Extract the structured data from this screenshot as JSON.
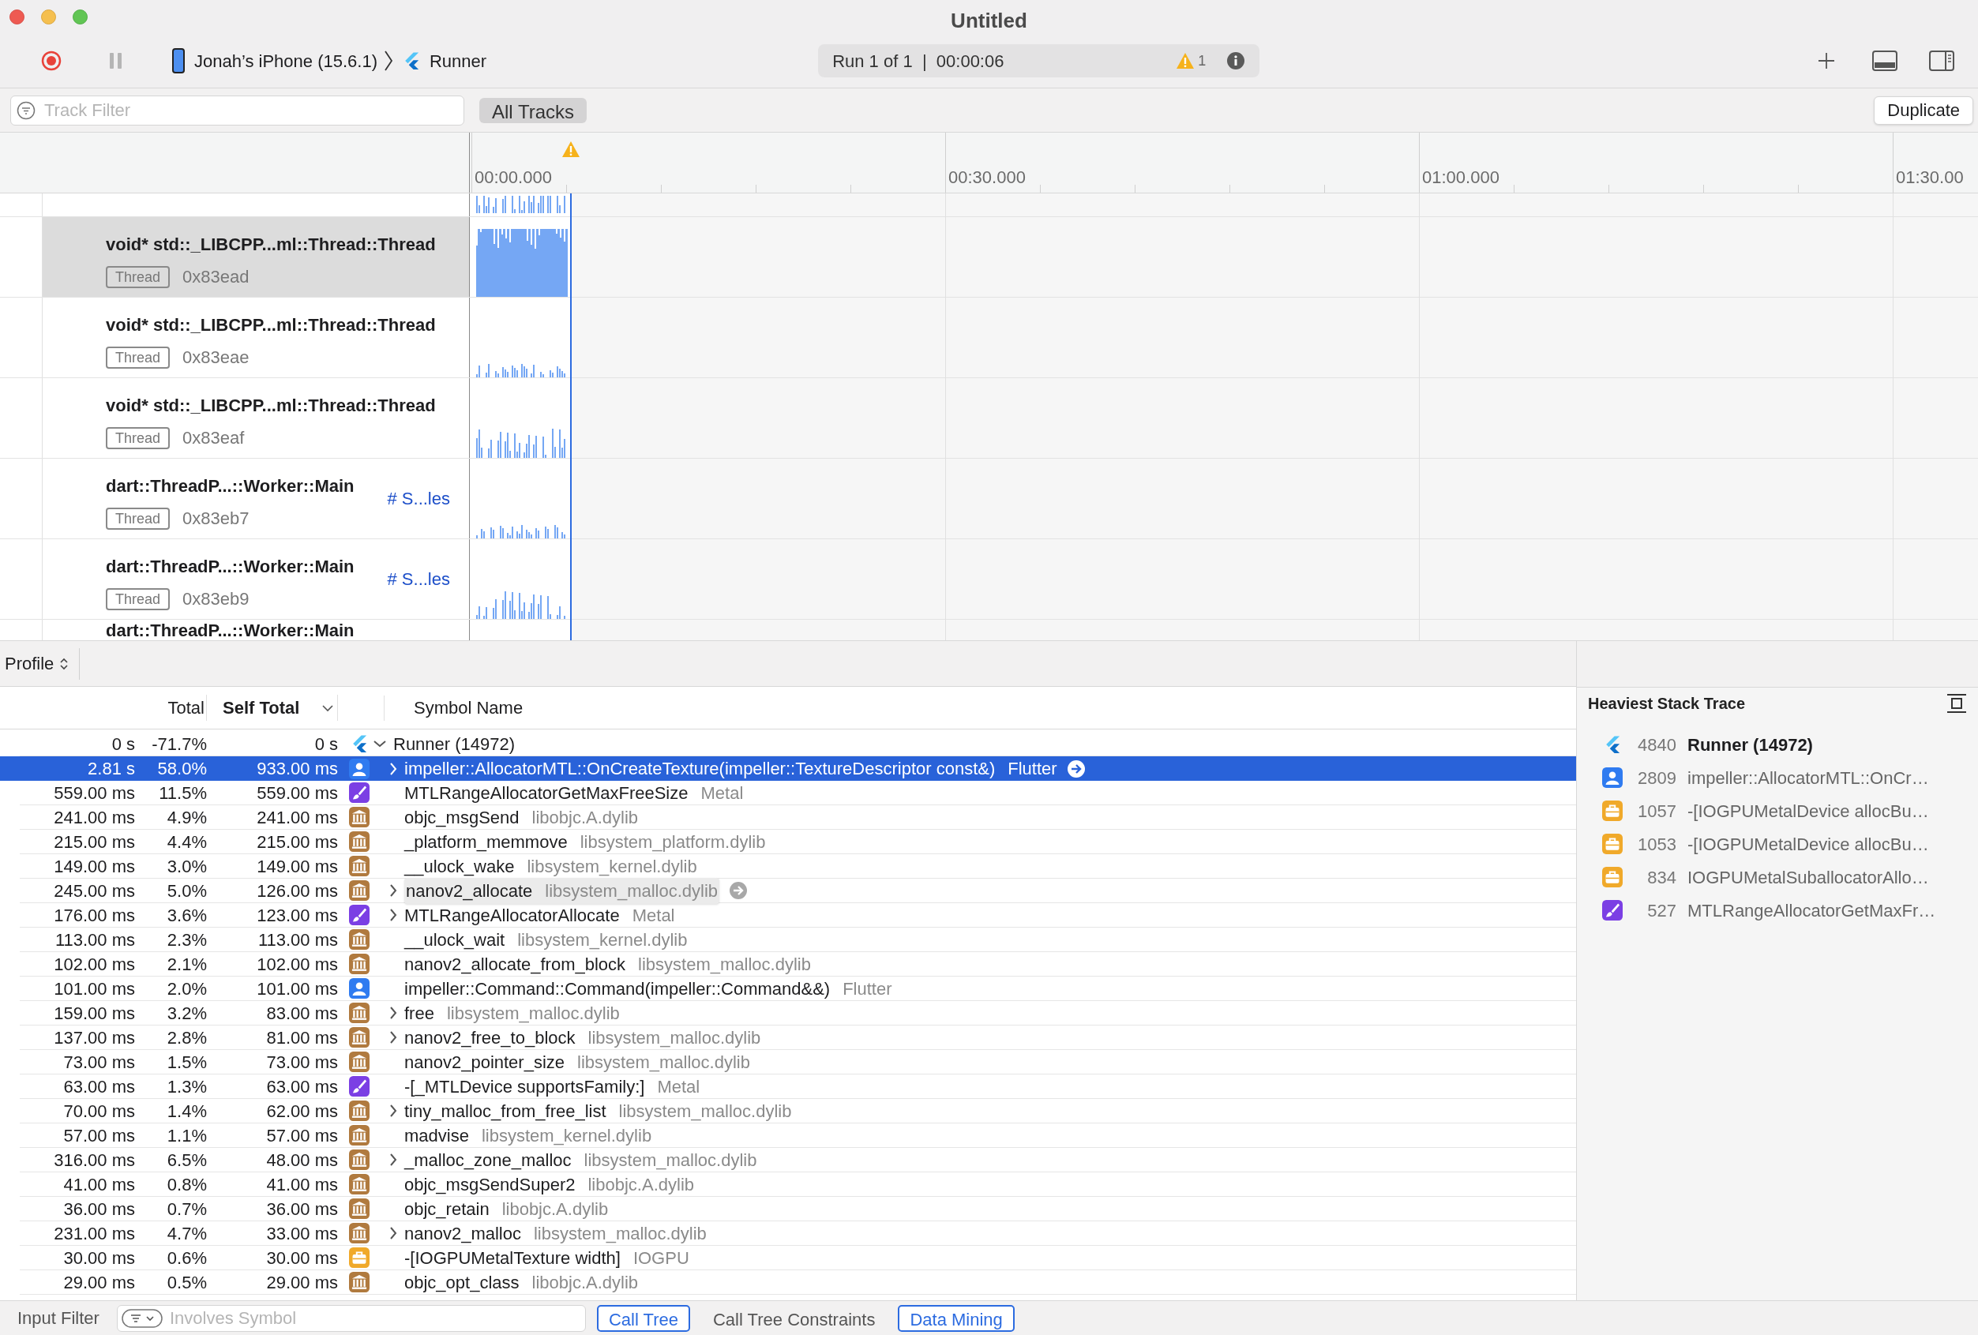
{
  "window": {
    "title": "Untitled"
  },
  "toolbar": {
    "device": "Jonah’s iPhone (15.6.1)",
    "target": "Runner",
    "run_status": "Run 1 of 1  |  00:00:06",
    "warning_count": "1"
  },
  "filter_bar": {
    "placeholder": "Track Filter",
    "scope_button": "All Tracks",
    "duplicate_button": "Duplicate"
  },
  "timeline": {
    "ticks": [
      "00:00.000",
      "00:30.000",
      "01:00.000",
      "01:30.00"
    ]
  },
  "tracks": [
    {
      "name": "void* std::_LIBCPP...ml::Thread::Thread",
      "tag": "Thread",
      "id": "0x83ead",
      "selected": true
    },
    {
      "name": "void* std::_LIBCPP...ml::Thread::Thread",
      "tag": "Thread",
      "id": "0x83eae",
      "selected": false
    },
    {
      "name": "void* std::_LIBCPP...ml::Thread::Thread",
      "tag": "Thread",
      "id": "0x83eaf",
      "selected": false
    },
    {
      "name": "dart::ThreadP...::Worker::Main",
      "tag": "Thread",
      "id": "0x83eb7",
      "link": "# S...les",
      "selected": false
    },
    {
      "name": "dart::ThreadP...::Worker::Main",
      "tag": "Thread",
      "id": "0x83eb9",
      "link": "# S...les",
      "selected": false
    },
    {
      "name": "dart::ThreadP...::Worker::Main",
      "selected": false
    }
  ],
  "profile": {
    "view_menu": "Profile",
    "columns": {
      "total": "Total",
      "self_total": "Self Total",
      "symbol": "Symbol Name"
    },
    "rows": [
      {
        "total": "0 s",
        "percent": "-71.7%",
        "self": "0 s",
        "kind": "flutter",
        "expandable": true,
        "expanded": true,
        "symbol": "Runner (14972)",
        "selected": false,
        "focused": false,
        "children": [
          {
            "total": "2.81 s",
            "percent": "58.0%",
            "self": "933.00 ms",
            "kind": "user",
            "expandable": true,
            "expanded": false,
            "symbol": "impeller::AllocatorMTL::OnCreateTexture(impeller::TextureDescriptor const&)",
            "library": "Flutter",
            "selected": true,
            "focused": false
          },
          {
            "total": "559.00 ms",
            "percent": "11.5%",
            "self": "559.00 ms",
            "kind": "metal",
            "expandable": false,
            "symbol": "MTLRangeAllocatorGetMaxFreeSize",
            "library": "Metal",
            "selected": false,
            "focused": false
          },
          {
            "total": "241.00 ms",
            "percent": "4.9%",
            "self": "241.00 ms",
            "kind": "library",
            "expandable": false,
            "symbol": "objc_msgSend",
            "library": "libobjc.A.dylib",
            "selected": false,
            "focused": false
          },
          {
            "total": "215.00 ms",
            "percent": "4.4%",
            "self": "215.00 ms",
            "kind": "library",
            "expandable": false,
            "symbol": "_platform_memmove",
            "library": "libsystem_platform.dylib",
            "selected": false,
            "focused": false
          },
          {
            "total": "149.00 ms",
            "percent": "3.0%",
            "self": "149.00 ms",
            "kind": "library",
            "expandable": false,
            "symbol": "__ulock_wake",
            "library": "libsystem_kernel.dylib",
            "selected": false,
            "focused": false
          },
          {
            "total": "245.00 ms",
            "percent": "5.0%",
            "self": "126.00 ms",
            "kind": "library",
            "expandable": true,
            "expanded": false,
            "symbol": "nanov2_allocate",
            "library": "libsystem_malloc.dylib",
            "selected": false,
            "focused": true
          },
          {
            "total": "176.00 ms",
            "percent": "3.6%",
            "self": "123.00 ms",
            "kind": "metal",
            "expandable": true,
            "expanded": false,
            "symbol": "MTLRangeAllocatorAllocate",
            "library": "Metal",
            "selected": false,
            "focused": false
          },
          {
            "total": "113.00 ms",
            "percent": "2.3%",
            "self": "113.00 ms",
            "kind": "library",
            "expandable": false,
            "symbol": "__ulock_wait",
            "library": "libsystem_kernel.dylib",
            "selected": false,
            "focused": false
          },
          {
            "total": "102.00 ms",
            "percent": "2.1%",
            "self": "102.00 ms",
            "kind": "library",
            "expandable": false,
            "symbol": "nanov2_allocate_from_block",
            "library": "libsystem_malloc.dylib",
            "selected": false,
            "focused": false
          },
          {
            "total": "101.00 ms",
            "percent": "2.0%",
            "self": "101.00 ms",
            "kind": "user",
            "expandable": false,
            "symbol": "impeller::Command::Command(impeller::Command&&)",
            "library": "Flutter",
            "selected": false,
            "focused": false
          },
          {
            "total": "159.00 ms",
            "percent": "3.2%",
            "self": "83.00 ms",
            "kind": "library",
            "expandable": true,
            "expanded": false,
            "symbol": "free",
            "library": "libsystem_malloc.dylib",
            "selected": false,
            "focused": false
          },
          {
            "total": "137.00 ms",
            "percent": "2.8%",
            "self": "81.00 ms",
            "kind": "library",
            "expandable": true,
            "expanded": false,
            "symbol": "nanov2_free_to_block",
            "library": "libsystem_malloc.dylib",
            "selected": false,
            "focused": false
          },
          {
            "total": "73.00 ms",
            "percent": "1.5%",
            "self": "73.00 ms",
            "kind": "library",
            "expandable": false,
            "symbol": "nanov2_pointer_size",
            "library": "libsystem_malloc.dylib",
            "selected": false,
            "focused": false
          },
          {
            "total": "63.00 ms",
            "percent": "1.3%",
            "self": "63.00 ms",
            "kind": "metal",
            "expandable": false,
            "symbol": "-[_MTLDevice supportsFamily:]",
            "library": "Metal",
            "selected": false,
            "focused": false
          },
          {
            "total": "70.00 ms",
            "percent": "1.4%",
            "self": "62.00 ms",
            "kind": "library",
            "expandable": true,
            "expanded": false,
            "symbol": "tiny_malloc_from_free_list",
            "library": "libsystem_malloc.dylib",
            "selected": false,
            "focused": false
          },
          {
            "total": "57.00 ms",
            "percent": "1.1%",
            "self": "57.00 ms",
            "kind": "library",
            "expandable": false,
            "symbol": "madvise",
            "library": "libsystem_kernel.dylib",
            "selected": false,
            "focused": false
          },
          {
            "total": "316.00 ms",
            "percent": "6.5%",
            "self": "48.00 ms",
            "kind": "library",
            "expandable": true,
            "expanded": false,
            "symbol": "_malloc_zone_malloc",
            "library": "libsystem_malloc.dylib",
            "selected": false,
            "focused": false
          },
          {
            "total": "41.00 ms",
            "percent": "0.8%",
            "self": "41.00 ms",
            "kind": "library",
            "expandable": false,
            "symbol": "objc_msgSendSuper2",
            "library": "libobjc.A.dylib",
            "selected": false,
            "focused": false
          },
          {
            "total": "36.00 ms",
            "percent": "0.7%",
            "self": "36.00 ms",
            "kind": "library",
            "expandable": false,
            "symbol": "objc_retain",
            "library": "libobjc.A.dylib",
            "selected": false,
            "focused": false
          },
          {
            "total": "231.00 ms",
            "percent": "4.7%",
            "self": "33.00 ms",
            "kind": "library",
            "expandable": true,
            "expanded": false,
            "symbol": "nanov2_malloc",
            "library": "libsystem_malloc.dylib",
            "selected": false,
            "focused": false
          },
          {
            "total": "30.00 ms",
            "percent": "0.6%",
            "self": "30.00 ms",
            "kind": "gpu",
            "expandable": false,
            "symbol": "-[IOGPUMetalTexture width]",
            "library": "IOGPU",
            "selected": false,
            "focused": false
          },
          {
            "total": "29.00 ms",
            "percent": "0.5%",
            "self": "29.00 ms",
            "kind": "library",
            "expandable": false,
            "symbol": "objc_opt_class",
            "library": "libobjc.A.dylib",
            "selected": false,
            "focused": false
          }
        ]
      }
    ]
  },
  "heaviest_stack_trace": {
    "title": "Heaviest Stack Trace",
    "items": [
      {
        "kind": "flutter",
        "count": "4840",
        "symbol": "Runner (14972)",
        "emphasized": true
      },
      {
        "kind": "user",
        "count": "2809",
        "symbol": "impeller::AllocatorMTL::OnCr…",
        "emphasized": false
      },
      {
        "kind": "gpu",
        "count": "1057",
        "symbol": "-[IOGPUMetalDevice allocBu…",
        "emphasized": false
      },
      {
        "kind": "gpu",
        "count": "1053",
        "symbol": "-[IOGPUMetalDevice allocBu…",
        "emphasized": false
      },
      {
        "kind": "gpu",
        "count": "834",
        "symbol": "IOGPUMetalSuballocatorAllo…",
        "emphasized": false
      },
      {
        "kind": "metal",
        "count": "527",
        "symbol": "MTLRangeAllocatorGetMaxFr…",
        "emphasized": false
      }
    ]
  },
  "bottom_bar": {
    "label": "Input Filter",
    "placeholder": "Involves Symbol",
    "buttons": [
      {
        "label": "Call Tree",
        "on": true
      },
      {
        "label": "Call Tree Constraints",
        "on": false
      },
      {
        "label": "Data Mining",
        "on": true
      }
    ]
  }
}
